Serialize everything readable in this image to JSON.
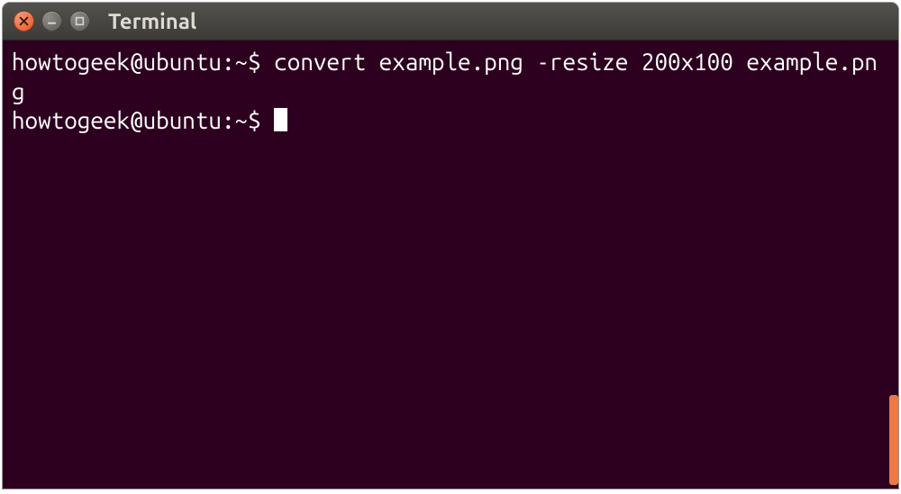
{
  "titlebar": {
    "title": "Terminal"
  },
  "terminal": {
    "line1_prompt": "howtogeek@ubuntu:~$ ",
    "line1_command": "convert example.png -resize 200x100 example.png",
    "line2_prompt": "howtogeek@ubuntu:~$ "
  }
}
